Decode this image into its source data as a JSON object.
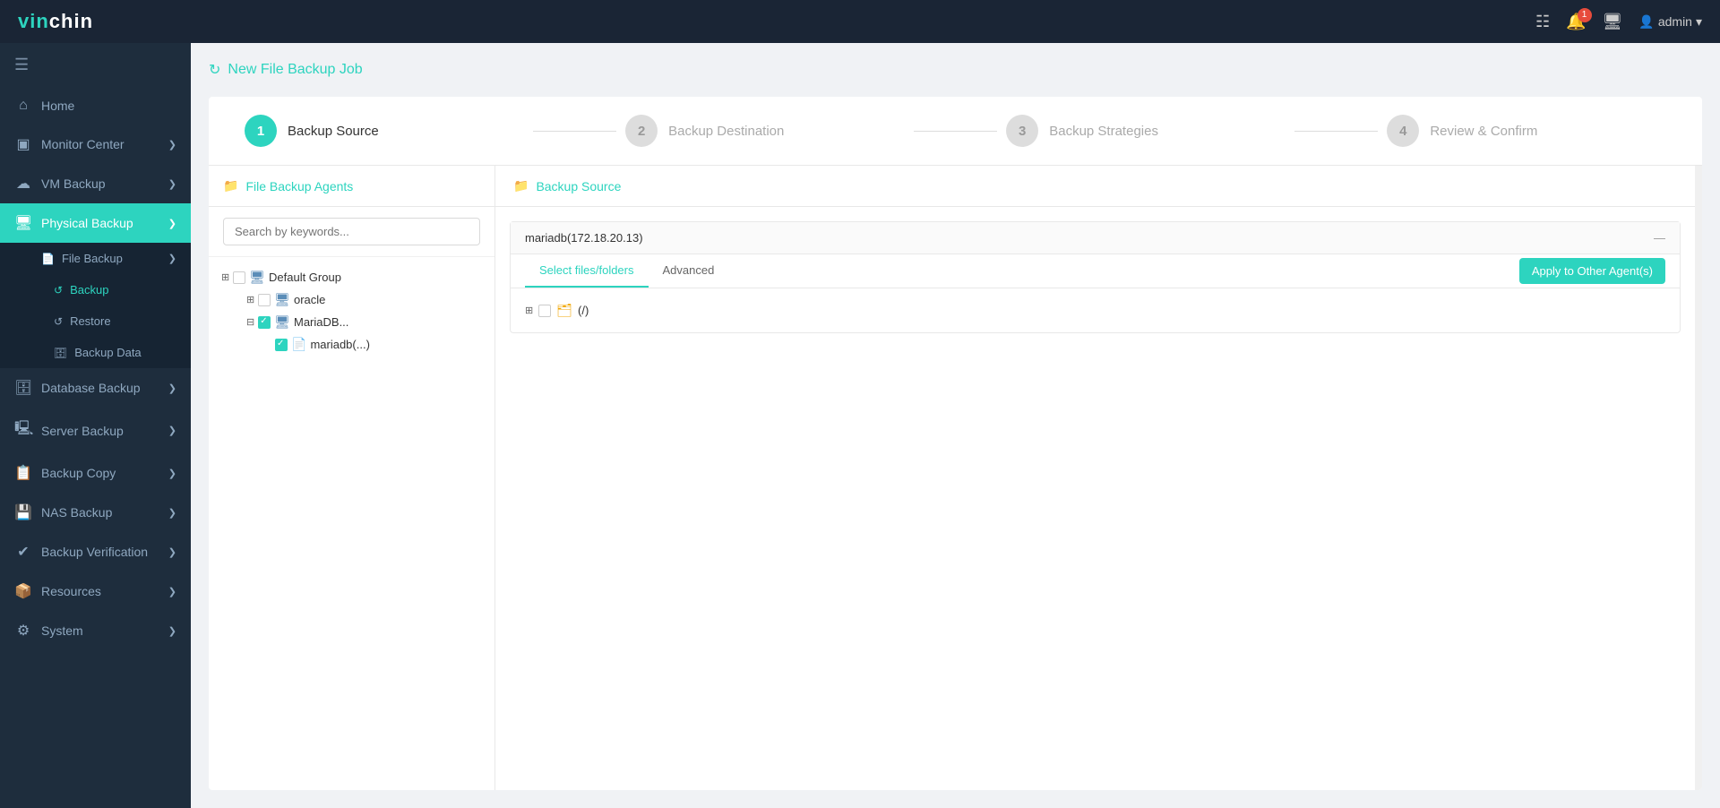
{
  "topnav": {
    "logo_vin": "vin",
    "logo_chin": "chin",
    "notif_count": "1",
    "admin_label": "admin"
  },
  "sidebar": {
    "items": [
      {
        "id": "home",
        "label": "Home",
        "icon": "⌂",
        "active": false,
        "hasChildren": false
      },
      {
        "id": "monitor-center",
        "label": "Monitor Center",
        "icon": "▣",
        "active": false,
        "hasChildren": true
      },
      {
        "id": "vm-backup",
        "label": "VM Backup",
        "icon": "☁",
        "active": false,
        "hasChildren": true
      },
      {
        "id": "physical-backup",
        "label": "Physical Backup",
        "icon": "🖥",
        "active": true,
        "hasChildren": true
      },
      {
        "id": "database-backup",
        "label": "Database Backup",
        "icon": "🗄",
        "active": false,
        "hasChildren": true
      },
      {
        "id": "server-backup",
        "label": "Server Backup",
        "icon": "🖳",
        "active": false,
        "hasChildren": true
      },
      {
        "id": "backup-copy",
        "label": "Backup Copy",
        "icon": "📋",
        "active": false,
        "hasChildren": true
      },
      {
        "id": "nas-backup",
        "label": "NAS Backup",
        "icon": "💾",
        "active": false,
        "hasChildren": true
      },
      {
        "id": "backup-verification",
        "label": "Backup Verification",
        "icon": "✔",
        "active": false,
        "hasChildren": true
      },
      {
        "id": "resources",
        "label": "Resources",
        "icon": "📦",
        "active": false,
        "hasChildren": true
      },
      {
        "id": "system",
        "label": "System",
        "icon": "⚙",
        "active": false,
        "hasChildren": true
      }
    ],
    "submenu": [
      {
        "id": "file-backup",
        "label": "File Backup",
        "icon": "📄",
        "active": false
      },
      {
        "id": "backup-sub",
        "label": "Backup",
        "icon": "↺",
        "active": true
      },
      {
        "id": "restore",
        "label": "Restore",
        "icon": "↺",
        "active": false
      },
      {
        "id": "backup-data",
        "label": "Backup Data",
        "icon": "🗄",
        "active": false
      }
    ]
  },
  "page": {
    "title": "New File Backup Job",
    "refresh_icon": "↻"
  },
  "wizard": {
    "steps": [
      {
        "num": "1",
        "label": "Backup Source",
        "active": true
      },
      {
        "num": "2",
        "label": "Backup Destination",
        "active": false
      },
      {
        "num": "3",
        "label": "Backup Strategies",
        "active": false
      },
      {
        "num": "4",
        "label": "Review & Confirm",
        "active": false
      }
    ]
  },
  "left_panel": {
    "header": "File Backup Agents",
    "search_placeholder": "Search by keywords...",
    "tree": [
      {
        "label": "Default Group",
        "level": 0,
        "expanded": true,
        "checked": false,
        "type": "group"
      },
      {
        "label": "oracle",
        "level": 1,
        "expanded": false,
        "checked": false,
        "type": "server"
      },
      {
        "label": "MariaDB...",
        "level": 1,
        "expanded": true,
        "checked": true,
        "type": "server"
      },
      {
        "label": "mariadb(...)",
        "level": 2,
        "expanded": false,
        "checked": true,
        "type": "db"
      }
    ]
  },
  "right_panel": {
    "header": "Backup Source",
    "agent_name": "mariadb(172.18.20.13)",
    "tabs": [
      {
        "label": "Select files/folders",
        "active": true
      },
      {
        "label": "Advanced",
        "active": false
      }
    ],
    "apply_btn": "Apply to Other Agent(s)",
    "file_tree": [
      {
        "label": "(/)",
        "type": "folder",
        "expanded": false,
        "checked": false
      }
    ]
  }
}
